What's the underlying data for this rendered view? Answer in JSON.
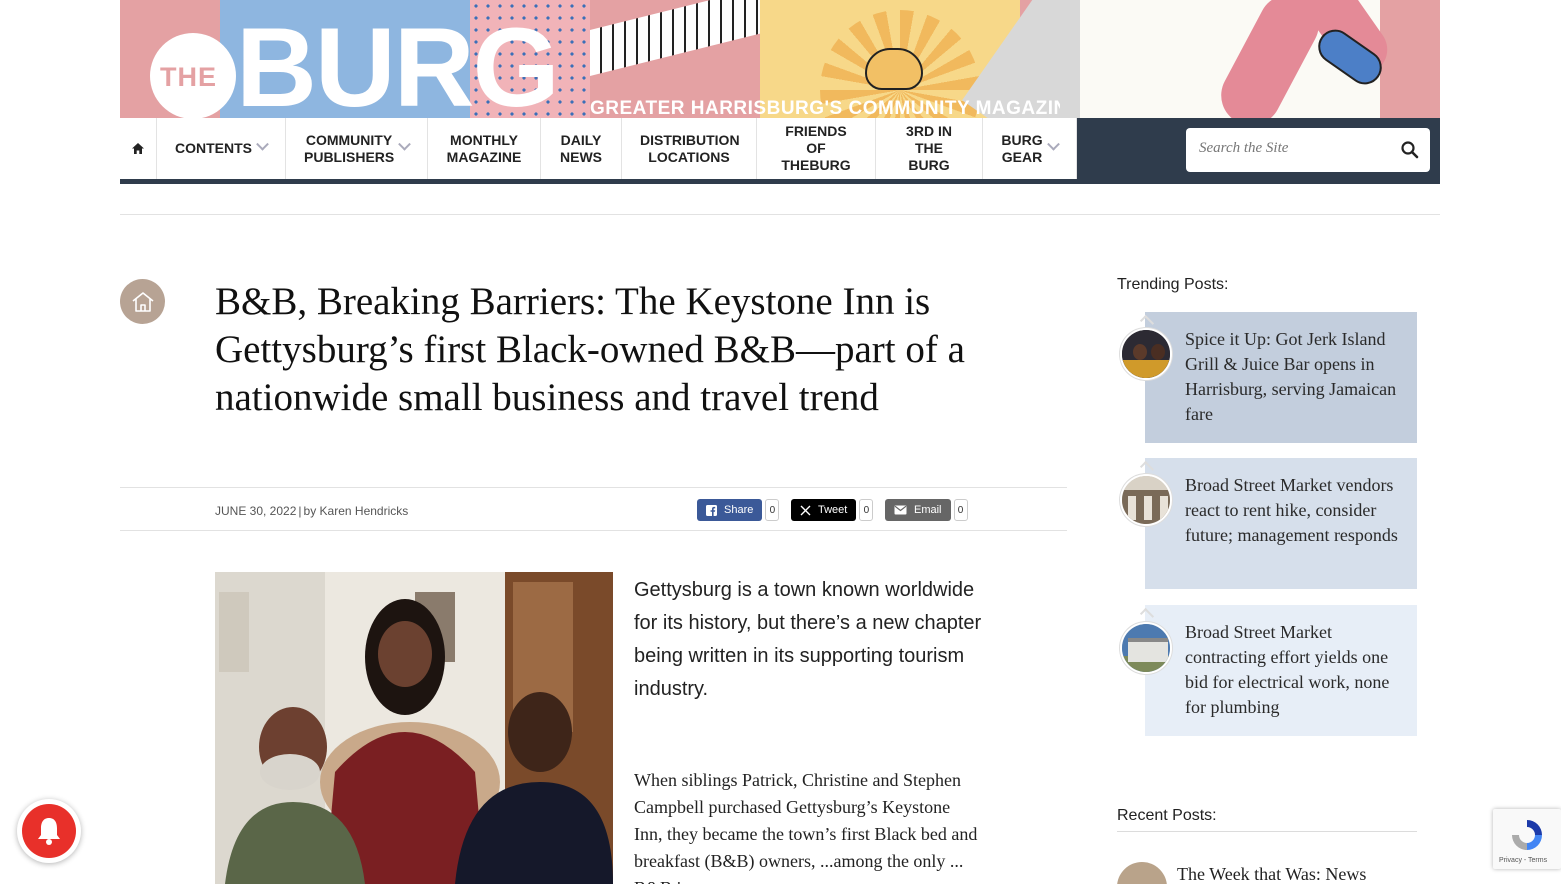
{
  "header": {
    "logo_the": "THE",
    "logo_burg": "BURG",
    "tagline": "GREATER HARRISBURG'S COMMUNITY MAGAZINE"
  },
  "nav": {
    "items": [
      {
        "label": "CONTENTS",
        "dropdown": true
      },
      {
        "label": "COMMUNITY PUBLISHERS",
        "dropdown": true
      },
      {
        "label": "MONTHLY MAGAZINE",
        "dropdown": false
      },
      {
        "label": "DAILY NEWS",
        "dropdown": false
      },
      {
        "label": "DISTRIBUTION LOCATIONS",
        "dropdown": false
      },
      {
        "label": "FRIENDS OF THEBURG",
        "dropdown": false
      },
      {
        "label": "3RD IN THE BURG",
        "dropdown": false
      },
      {
        "label": "BURG GEAR",
        "dropdown": true
      }
    ],
    "home_icon": "home-icon"
  },
  "search": {
    "placeholder": "Search the Site",
    "icon": "search-icon"
  },
  "article": {
    "title": "B&B, Breaking Barriers: The Keystone Inn is Gettysburg’s first Black-owned B&B—part of a nationwide small business and travel trend",
    "date": "JUNE 30, 2022",
    "by": "by",
    "author": "Karen Hendricks",
    "share": {
      "facebook": {
        "label": "Share",
        "count": "0",
        "color": "#3b5998"
      },
      "twitter": {
        "label": "Tweet",
        "count": "0",
        "color": "#000000"
      },
      "email": {
        "label": "Email",
        "count": "0",
        "color": "#666666"
      }
    },
    "lede": "Gettysburg is a town known worldwide for its history, but there’s a new chapter being written in its supporting tourism industry.",
    "body": "When siblings Patrick, Christine and Stephen Campbell purchased Gettysburg’s Keystone Inn, they became the town’s first Black bed and breakfast (B&B) owners, ...among the only ... B&B in..."
  },
  "sidebar": {
    "trending_heading": "Trending Posts:",
    "trending": [
      {
        "title": "Spice it Up: Got Jerk Island Grill & Juice Bar opens in Harrisburg, serving Jamaican fare",
        "bg": "#c3cedd"
      },
      {
        "title": "Broad Street Market vendors react to rent hike, consider future; management responds",
        "bg": "#d6dfeb"
      },
      {
        "title": "Broad Street Market contracting effort yields one bid for electrical work, none for plumbing",
        "bg": "#e7eef7"
      }
    ],
    "recent_heading": "Recent Posts:",
    "recent": [
      {
        "title": "The Week that Was: News"
      }
    ]
  },
  "widgets": {
    "recaptcha_label": "Privacy - Terms"
  }
}
